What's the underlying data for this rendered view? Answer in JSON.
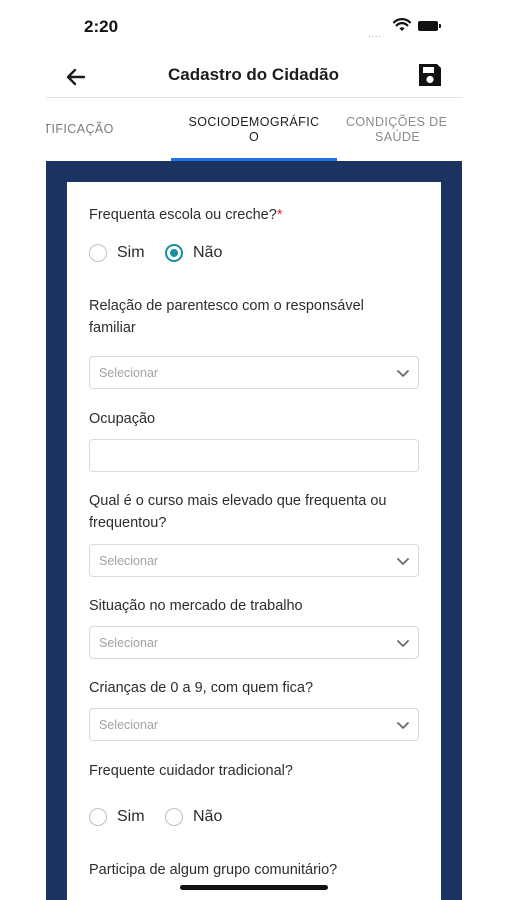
{
  "status_bar": {
    "time": "2:20",
    "signal": "....",
    "wifi_icon": "wifi-icon",
    "battery_icon": "battery-icon"
  },
  "header": {
    "title": "Cadastro do Cidadão",
    "back_icon": "arrow-left-icon",
    "save_icon": "save-icon"
  },
  "tabs": [
    {
      "line1": "IDENTIFICAÇÃO",
      "line2": ""
    },
    {
      "line1": "SOCIODEMOGRÁFIC",
      "line2": "O"
    },
    {
      "line1": "CONDIÇÕES DE",
      "line2": "SAÚDE"
    }
  ],
  "active_tab": 1,
  "colors": {
    "accent": "#1b74e4",
    "radio": "#1a8fa0",
    "panel": "#1c3462",
    "required": "#e0243b"
  },
  "form": {
    "school": {
      "label": "Frequenta escola ou creche?",
      "required_mark": "*",
      "options": [
        "Sim",
        "Não"
      ],
      "selected": "Não"
    },
    "kinship": {
      "label": "Relação de parentesco com o responsável familiar",
      "placeholder": "Selecionar"
    },
    "occupation": {
      "label": "Ocupação",
      "value": ""
    },
    "education": {
      "label": "Qual é o curso mais elevado que frequenta ou frequentou?",
      "placeholder": "Selecionar"
    },
    "work": {
      "label": "Situação no mercado de trabalho",
      "placeholder": "Selecionar"
    },
    "children": {
      "label": "Crianças de 0 a 9, com quem fica?",
      "placeholder": "Selecionar"
    },
    "caregiver": {
      "label": "Frequente cuidador tradicional?",
      "options": [
        "Sim",
        "Não"
      ],
      "selected": ""
    },
    "community": {
      "label": "Participa de algum grupo comunitário?"
    }
  }
}
